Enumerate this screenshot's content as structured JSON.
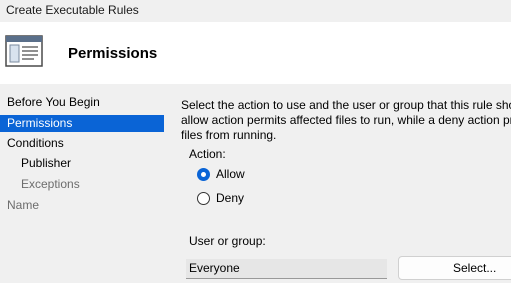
{
  "window": {
    "title": "Create Executable Rules"
  },
  "header": {
    "title": "Permissions",
    "icon": "wizard-page-icon"
  },
  "sidebar": {
    "items": [
      {
        "label": "Before You Begin",
        "state": "normal"
      },
      {
        "label": "Permissions",
        "state": "selected"
      },
      {
        "label": "Conditions",
        "state": "normal"
      },
      {
        "label": "Publisher",
        "state": "normal"
      },
      {
        "label": "Exceptions",
        "state": "disabled"
      },
      {
        "label": "Name",
        "state": "disabled"
      }
    ]
  },
  "main": {
    "description_lines": [
      "Select the action to use and the user or group that this rule should a",
      "allow action permits affected files to run, while a deny action preve",
      "files from running."
    ],
    "action_label": "Action:",
    "actions": [
      {
        "label": "Allow",
        "checked": true
      },
      {
        "label": "Deny",
        "checked": false
      }
    ],
    "user_label": "User or group:",
    "user_value": "Everyone",
    "select_button": "Select..."
  },
  "colors": {
    "accent": "#0a64d6",
    "panel_background": "#f0f0f0",
    "disabled_text": "#6d6d6d"
  }
}
